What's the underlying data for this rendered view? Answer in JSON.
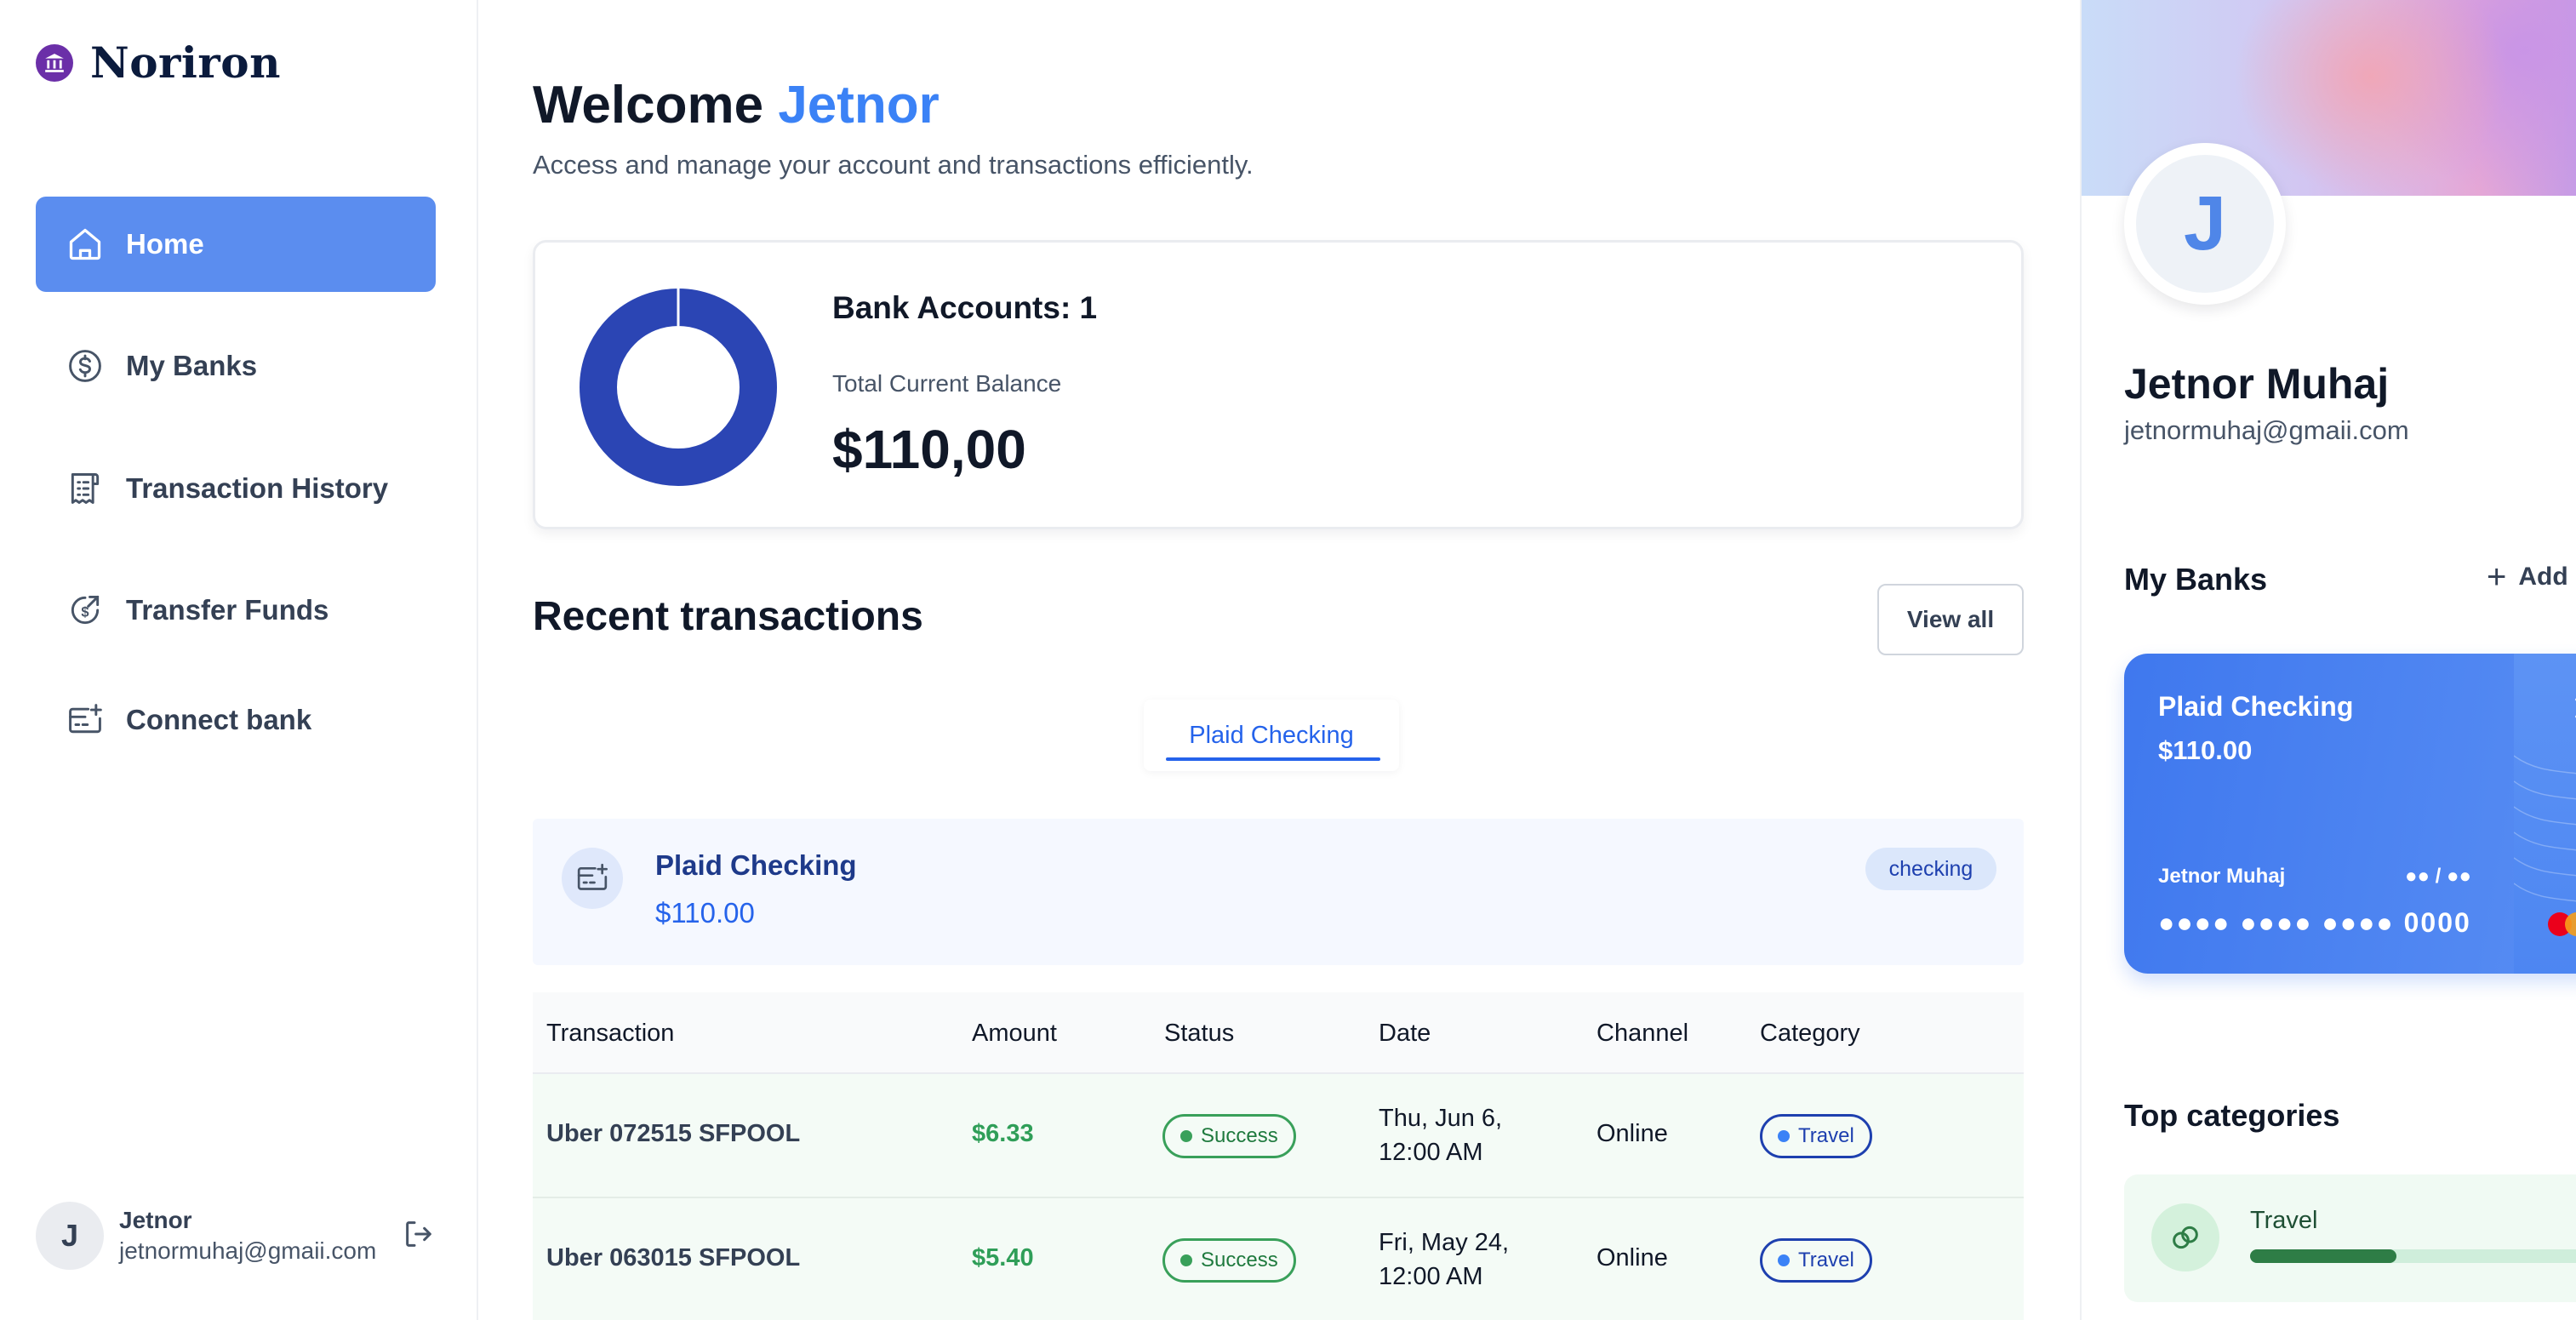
{
  "brand": {
    "name": "Noriron",
    "logo_icon": "bank-icon",
    "logo_color": "#6b2fa8"
  },
  "sidebar": {
    "items": [
      {
        "label": "Home",
        "icon": "home-icon",
        "active": true
      },
      {
        "label": "My Banks",
        "icon": "dollar-circle-icon",
        "active": false
      },
      {
        "label": "Transaction History",
        "icon": "receipt-icon",
        "active": false
      },
      {
        "label": "Transfer Funds",
        "icon": "money-send-icon",
        "active": false
      },
      {
        "label": "Connect bank",
        "icon": "card-add-icon",
        "active": false
      }
    ],
    "user": {
      "initial": "J",
      "name": "Jetnor",
      "email": "jetnormuhaj@gmaii.com",
      "logout_icon": "logout-icon"
    }
  },
  "header": {
    "welcome_prefix": "Welcome",
    "user_first_name": "Jetnor",
    "subtitle": "Access and manage your account and transactions efficiently."
  },
  "balance": {
    "accounts_label": "Bank Accounts: 1",
    "total_label": "Total Current Balance",
    "total_value": "$110,00",
    "chart_data": {
      "type": "pie",
      "categories": [
        "Plaid Checking"
      ],
      "values": [
        110.0
      ],
      "colors": [
        "#2b45b4"
      ]
    }
  },
  "recent": {
    "title": "Recent transactions",
    "view_all_label": "View all",
    "tabs": [
      {
        "label": "Plaid Checking",
        "active": true
      }
    ],
    "account": {
      "name": "Plaid Checking",
      "balance": "$110.00",
      "type_badge": "checking",
      "icon": "card-add-icon"
    },
    "columns": [
      "Transaction",
      "Amount",
      "Status",
      "Date",
      "Channel",
      "Category"
    ],
    "rows": [
      {
        "transaction": "Uber 072515 SFPOOL",
        "amount": "$6.33",
        "status": "Success",
        "date_line1": "Thu, Jun 6,",
        "date_line2": "12:00 AM",
        "channel": "Online",
        "category": "Travel"
      },
      {
        "transaction": "Uber 063015 SFPOOL",
        "amount": "$5.40",
        "status": "Success",
        "date_line1": "Fri, May 24,",
        "date_line2": "12:00 AM",
        "channel": "Online",
        "category": "Travel"
      }
    ]
  },
  "profile": {
    "initial": "J",
    "name": "Jetnor Muhaj",
    "email": "jetnormuhaj@gmaii.com"
  },
  "my_banks": {
    "title": "My Banks",
    "add_label": "Add",
    "card": {
      "bank_name": "Plaid Checking",
      "balance": "$110.00",
      "holder": "Jetnor Muhaj",
      "expiry": "●● / ●●",
      "number": "●●●● ●●●● ●●●● 0000",
      "network_icon": "mastercard-icon",
      "contactless_icon": "contactless-icon"
    }
  },
  "top_categories": {
    "title": "Top categories",
    "items": [
      {
        "name": "Travel",
        "icon": "link-icon",
        "progress": 0.38
      }
    ]
  },
  "colors": {
    "accent": "#3b82f6",
    "nav_active": "#5b8def",
    "success": "#39a05a",
    "category": "#1e40af"
  }
}
